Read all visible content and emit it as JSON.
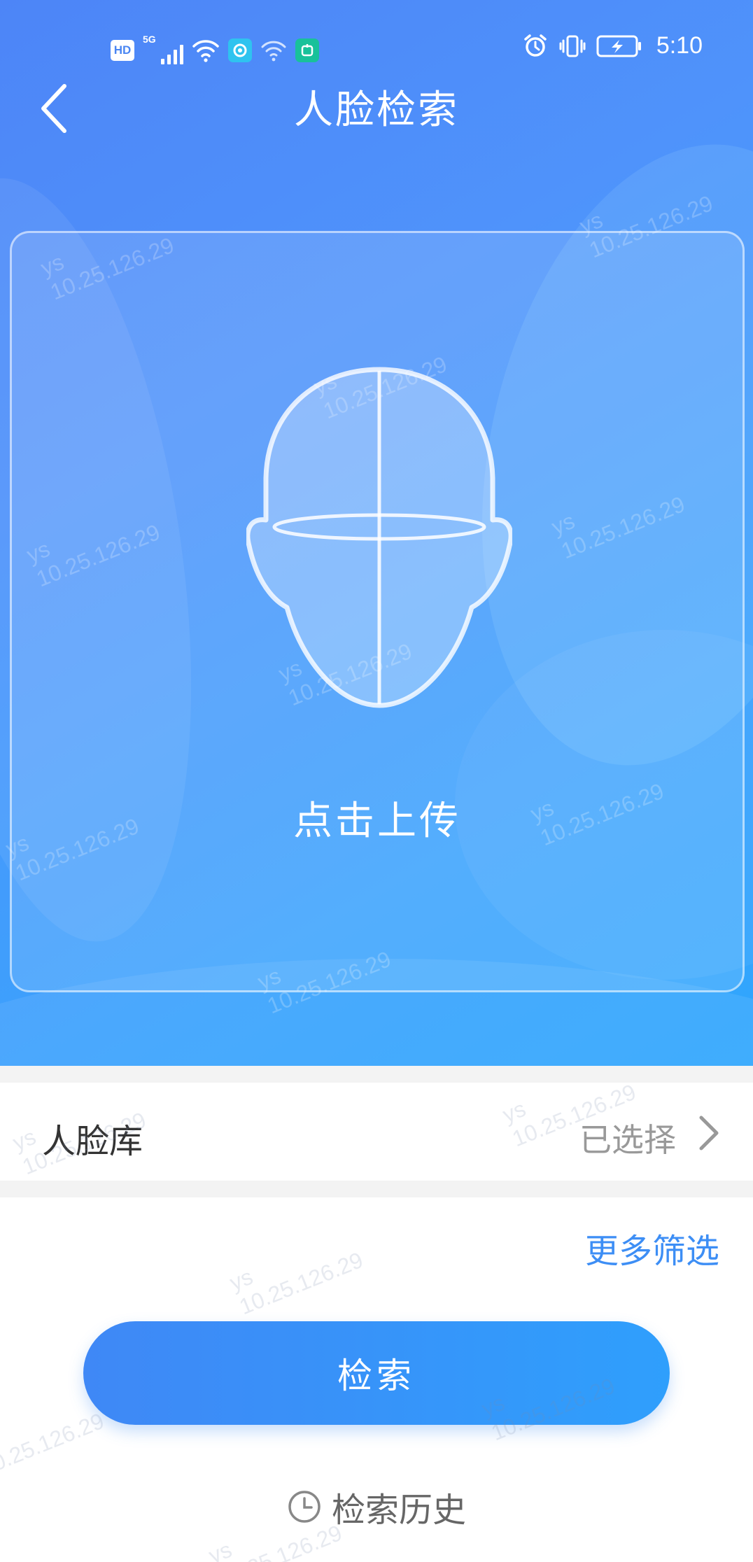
{
  "status_bar": {
    "hd": "HD",
    "network": "5G",
    "time": "5:10"
  },
  "nav": {
    "title": "人脸检索"
  },
  "upload": {
    "label": "点击上传"
  },
  "face_library": {
    "label": "人脸库",
    "value": "已选择"
  },
  "filters": {
    "more_label": "更多筛选"
  },
  "actions": {
    "search_label": "检索",
    "history_label": "检索历史"
  },
  "watermark": {
    "user": "ys",
    "ip": "10.25.126.29"
  },
  "colors": {
    "hero_start": "#4d85f7",
    "hero_end": "#2fa6fd",
    "accent": "#3d8ef5"
  }
}
